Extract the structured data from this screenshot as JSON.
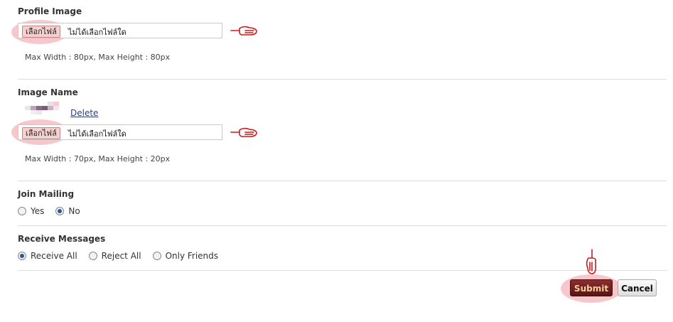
{
  "profile_image": {
    "title": "Profile Image",
    "choose_button": "เลือกไฟล์",
    "file_status": "ไม่ได้เลือกไฟล์ใด",
    "hint": "Max Width : 80px, Max Height : 80px"
  },
  "image_name": {
    "title": "Image Name",
    "delete_link": "Delete",
    "choose_button": "เลือกไฟล์",
    "file_status": "ไม่ได้เลือกไฟล์ใด",
    "hint": "Max Width : 70px, Max Height : 20px"
  },
  "join_mailing": {
    "title": "Join Mailing",
    "options": [
      "Yes",
      "No"
    ],
    "selected": "No"
  },
  "receive_messages": {
    "title": "Receive Messages",
    "options": [
      "Receive All",
      "Reject All",
      "Only Friends"
    ],
    "selected": "Receive All"
  },
  "actions": {
    "submit_label": "Submit",
    "cancel_label": "Cancel"
  },
  "colors": {
    "highlight": "#f0828c",
    "submit_bg": "#6e1f1f",
    "submit_text": "#f5d09a",
    "link": "#2c3f7d",
    "hand_outline": "#cc1a1a"
  }
}
